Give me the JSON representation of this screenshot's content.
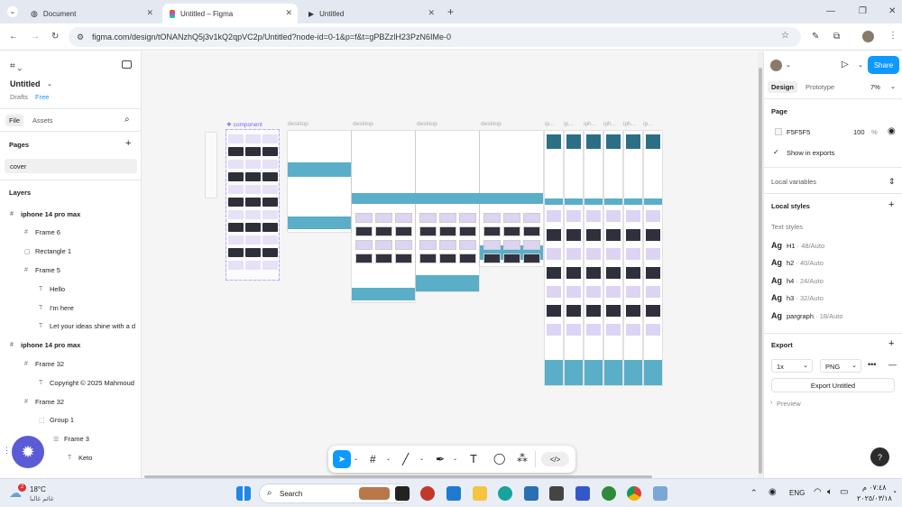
{
  "browser": {
    "tabs": [
      {
        "label": "Document"
      },
      {
        "label": "Untitled – Figma"
      },
      {
        "label": "Untitled"
      }
    ],
    "url": "figma.com/design/tONANzhQ5j3v1kQ2qpVC2p/Untitled?node-id=0-1&p=f&t=gPBZzlH23PzN6IMe-0"
  },
  "left_panel": {
    "file_name": "Untitled",
    "drafts": "Drafts",
    "plan": "Free",
    "tabs": {
      "file": "File",
      "assets": "Assets"
    },
    "pages_title": "Pages",
    "pages": [
      "cover"
    ],
    "layers_title": "Layers",
    "layers": [
      {
        "label": "iphone 14 pro max",
        "depth": 0,
        "icon": "frame-icon"
      },
      {
        "label": "Frame 6",
        "depth": 1,
        "icon": "frame-icon"
      },
      {
        "label": "Rectangle 1",
        "depth": 1,
        "icon": "rectangle-icon"
      },
      {
        "label": "Frame 5",
        "depth": 1,
        "icon": "frame-icon"
      },
      {
        "label": "Hello",
        "depth": 2,
        "icon": "text-icon"
      },
      {
        "label": "I'm here",
        "depth": 2,
        "icon": "text-icon"
      },
      {
        "label": "Let your ideas shine with a d",
        "depth": 2,
        "icon": "text-icon"
      },
      {
        "label": "iphone 14 pro max",
        "depth": 0,
        "icon": "frame-icon"
      },
      {
        "label": "Frame 32",
        "depth": 1,
        "icon": "frame-icon"
      },
      {
        "label": "Copyright © 2025 Mahmoud",
        "depth": 2,
        "icon": "text-icon"
      },
      {
        "label": "Frame 32",
        "depth": 1,
        "icon": "frame-icon"
      },
      {
        "label": "Group 1",
        "depth": 2,
        "icon": "group-icon"
      },
      {
        "label": "Frame 3",
        "depth": 3,
        "icon": "autolayout-icon"
      },
      {
        "label": "Keto",
        "depth": 4,
        "icon": "text-icon"
      }
    ]
  },
  "canvas": {
    "frame_labels": [
      "component",
      "desktop",
      "desktop",
      "desktop",
      "desktop",
      "ip...",
      "ip...",
      "iph...",
      "iph...",
      "iph...",
      "ip..."
    ],
    "accent_color": "#5aaec8",
    "component_color": "#7b61ff"
  },
  "toolbar": {
    "tools": [
      "move-tool",
      "frame-tool",
      "line-tool",
      "pen-tool",
      "text-tool",
      "comment-tool",
      "components-tool",
      "dev-mode-toggle"
    ]
  },
  "right_panel": {
    "share_label": "Share",
    "tabs": {
      "design": "Design",
      "prototype": "Prototype"
    },
    "zoom": "7%",
    "page_section": "Page",
    "page_color": "F5F5F5",
    "page_opacity": "100",
    "percent": "%",
    "show_in_exports": "Show in exports",
    "local_variables": "Local variables",
    "local_styles": "Local styles",
    "text_styles_title": "Text styles",
    "ag": "Ag",
    "text_styles": [
      {
        "name": "H1",
        "meta": " · 48/Auto"
      },
      {
        "name": "h2",
        "meta": " · 40/Auto"
      },
      {
        "name": "h4",
        "meta": " · 24/Auto"
      },
      {
        "name": "h3",
        "meta": " · 32/Auto"
      },
      {
        "name": "pargraph",
        "meta": " · 18/Auto"
      }
    ],
    "export_title": "Export",
    "export_scale": "1x",
    "export_format": "PNG",
    "export_button": "Export Untitled",
    "preview": "Preview",
    "help": "?"
  },
  "taskbar": {
    "temperature": "18°C",
    "weather_sub": "غائم غالبا",
    "notification_count": "2",
    "search": "Search",
    "language": "ENG",
    "time": "٠٧:٤٨ م",
    "date": "٢٠٢٥/٠٣/١٨"
  },
  "colors": {
    "share_bg": "#0d99ff",
    "selected_tool": "#0d99ff",
    "taskbar_bg": "#e9eef6"
  }
}
